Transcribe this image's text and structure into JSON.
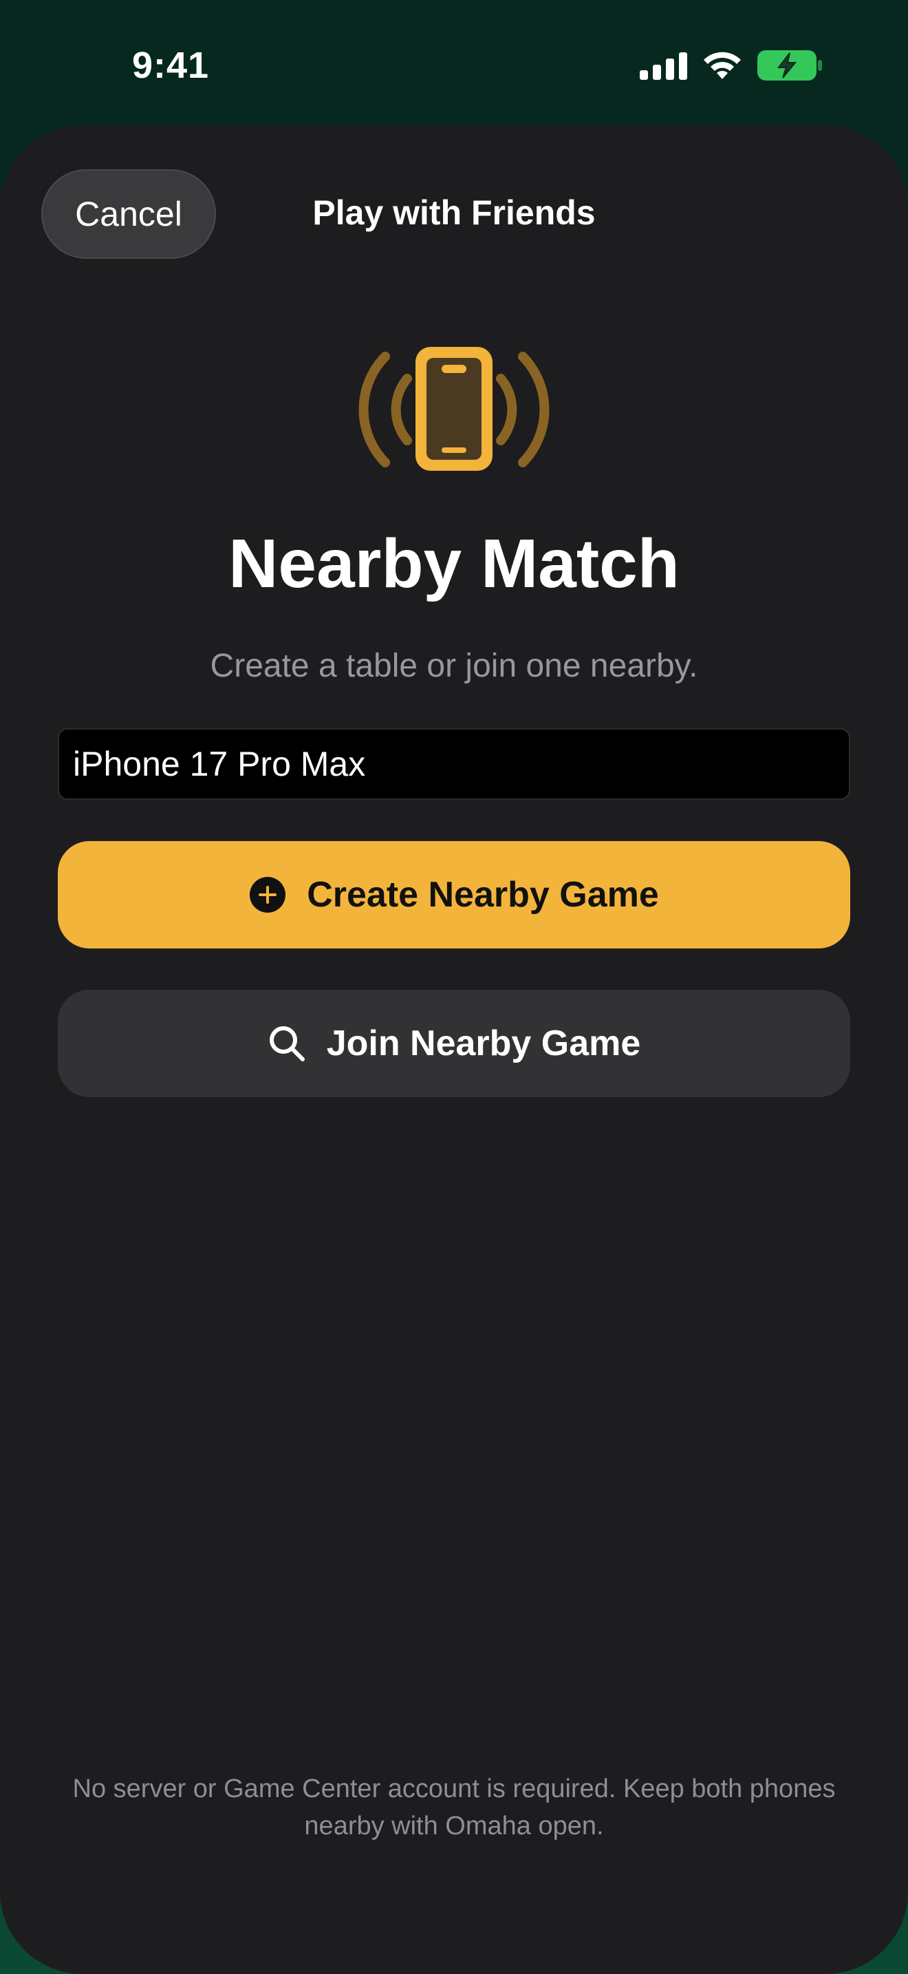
{
  "status_bar": {
    "time": "9:41"
  },
  "header": {
    "cancel_label": "Cancel",
    "title": "Play with Friends"
  },
  "hero": {
    "icon": "iphone-radiowaves-icon",
    "title": "Nearby Match",
    "subtitle": "Create a table or join one nearby."
  },
  "name_field": {
    "value": "iPhone 17 Pro Max"
  },
  "actions": {
    "create_label": "Create Nearby Game",
    "create_icon": "plus-circle-icon",
    "join_label": "Join Nearby Game",
    "join_icon": "search-icon"
  },
  "footer": {
    "note": "No server or Game Center account is required. Keep both phones nearby with Omaha open."
  },
  "colors": {
    "accent": "#f3b43b",
    "sheet": "#1d1d1f",
    "background": "#06281f",
    "battery": "#34c759"
  }
}
